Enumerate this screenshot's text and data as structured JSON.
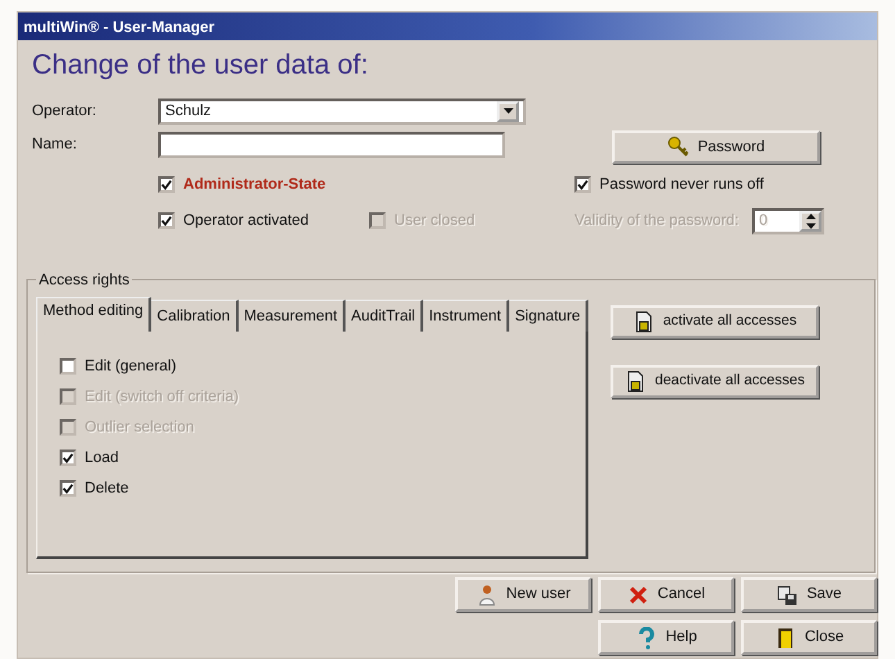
{
  "window": {
    "title": "multiWin® - User-Manager"
  },
  "heading": "Change of the user data of:",
  "fields": [
    {
      "label": "Operator:",
      "kind": "combo",
      "value": "Schulz"
    },
    {
      "label": "Name:",
      "kind": "text"
    }
  ],
  "password_button": {
    "label": "Password"
  },
  "options": [
    {
      "label": "Administrator-State",
      "checked": true,
      "disabled": false,
      "highlighted": true
    },
    {
      "label": "Password never runs off",
      "checked": true,
      "disabled": false,
      "highlighted": false
    },
    {
      "label": "Operator activated",
      "checked": true,
      "disabled": false,
      "highlighted": false
    },
    {
      "label": "User closed",
      "checked": false,
      "disabled": true,
      "highlighted": false
    }
  ],
  "validity": {
    "label": "Validity of the password:",
    "value": "0",
    "disabled": true
  },
  "access_rights": {
    "title": "Access rights",
    "tabs": [
      {
        "label": "Method editing",
        "selected": true
      },
      {
        "label": "Calibration",
        "selected": false
      },
      {
        "label": "Measurement",
        "selected": false
      },
      {
        "label": "AuditTrail",
        "selected": false
      },
      {
        "label": "Instrument",
        "selected": false
      },
      {
        "label": "Signature",
        "selected": false
      }
    ],
    "rights": [
      {
        "label": "Edit (general)",
        "checked": false,
        "disabled": false
      },
      {
        "label": "Edit (switch off criteria)",
        "checked": false,
        "disabled": true
      },
      {
        "label": "Outlier selection",
        "checked": false,
        "disabled": true
      },
      {
        "label": "Load",
        "checked": true,
        "disabled": false
      },
      {
        "label": "Delete",
        "checked": true,
        "disabled": false
      }
    ],
    "buttons": [
      {
        "label": "activate all accesses"
      },
      {
        "label": "deactivate all accesses"
      }
    ]
  },
  "footer_buttons": [
    {
      "label": "New user",
      "kind": "new-user"
    },
    {
      "label": "Cancel",
      "kind": "cancel"
    },
    {
      "label": "Save",
      "kind": "save"
    },
    {
      "label": "Help",
      "kind": "help"
    },
    {
      "label": "Close",
      "kind": "close"
    }
  ]
}
